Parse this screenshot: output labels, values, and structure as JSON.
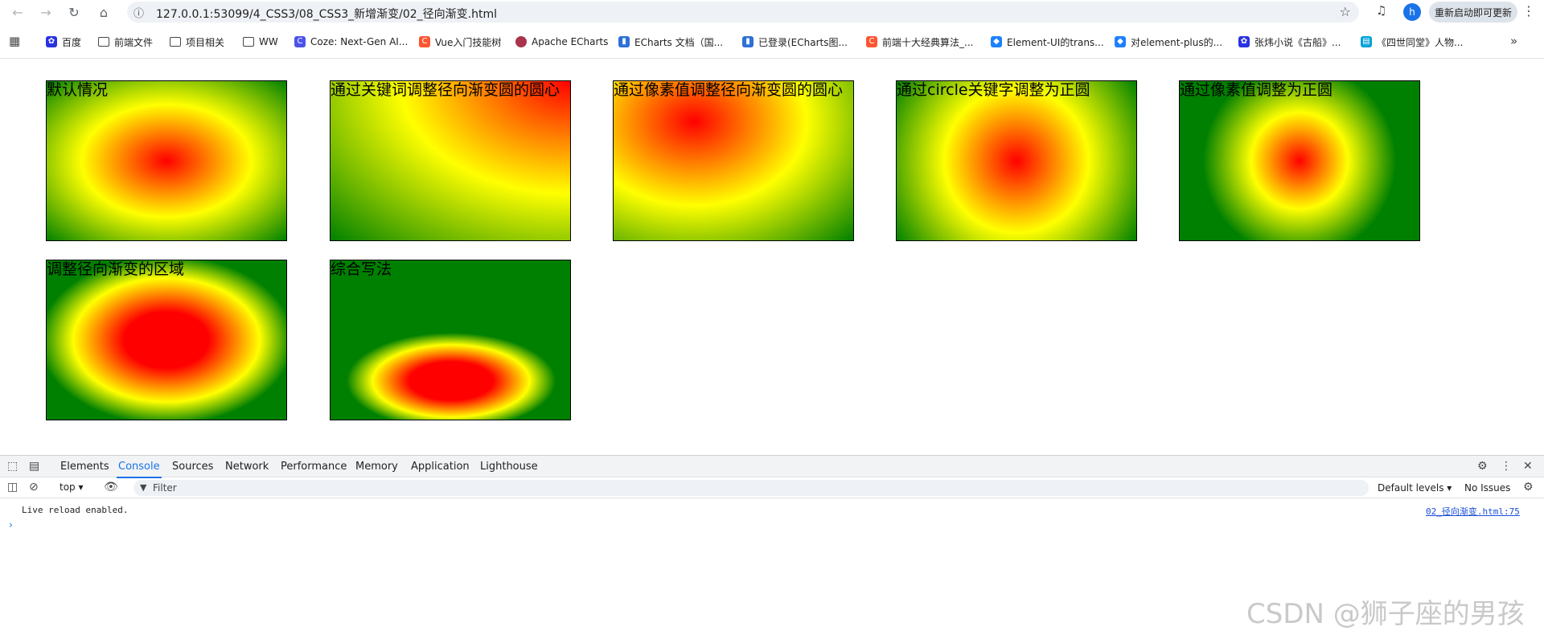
{
  "browser": {
    "url": "127.0.0.1:53099/4_CSS3/08_CSS3_新增渐变/02_径向渐变.html",
    "avatar_letter": "h",
    "update_button": "重新启动即可更新"
  },
  "bookmarks": [
    {
      "label": "百度",
      "icon": "paw-icon",
      "color": "#2932e1"
    },
    {
      "label": "前端文件",
      "icon": "folder-icon"
    },
    {
      "label": "项目相关",
      "icon": "folder-icon"
    },
    {
      "label": "WW",
      "icon": "folder-icon"
    },
    {
      "label": "Coze: Next-Gen AI...",
      "icon": "coze-icon",
      "color": "#4d53e8"
    },
    {
      "label": "Vue入门技能树",
      "icon": "csdn-icon",
      "color": "#fc5531"
    },
    {
      "label": "Apache ECharts",
      "icon": "echarts-icon",
      "color": "#aa344d"
    },
    {
      "label": "ECharts 文档（国...",
      "icon": "chart-icon",
      "color": "#2f6fd8"
    },
    {
      "label": "已登录(ECharts图...",
      "icon": "chart-icon",
      "color": "#2f6fd8"
    },
    {
      "label": "前端十大经典算法_...",
      "icon": "csdn-icon",
      "color": "#fc5531"
    },
    {
      "label": "Element-UI的trans...",
      "icon": "juejin-icon",
      "color": "#1e80ff"
    },
    {
      "label": "对element-plus的...",
      "icon": "juejin-icon",
      "color": "#1e80ff"
    },
    {
      "label": "张炜小说《古船》...",
      "icon": "paw-icon",
      "color": "#2932e1"
    },
    {
      "label": "《四世同堂》人物...",
      "icon": "bilibili-icon",
      "color": "#00a1d6"
    }
  ],
  "boxes": [
    {
      "caption": "默认情况"
    },
    {
      "caption": "通过关键词调整径向渐变圆的圆心"
    },
    {
      "caption": "通过像素值调整径向渐变圆的圆心"
    },
    {
      "caption": "通过circle关键字调整为正圆"
    },
    {
      "caption": "通过像素值调整为正圆"
    },
    {
      "caption": "调整径向渐变的区域"
    },
    {
      "caption": "综合写法"
    }
  ],
  "gradient_colors": [
    "#ff0000",
    "#ffff00",
    "#008000"
  ],
  "devtools": {
    "tabs": [
      "Elements",
      "Console",
      "Sources",
      "Network",
      "Performance",
      "Memory",
      "Application",
      "Lighthouse"
    ],
    "active_tab": "Console",
    "context": "top",
    "filter_placeholder": "Filter",
    "levels": "Default levels",
    "issues": "No Issues",
    "console_message": "Live reload enabled.",
    "console_source": "02_径向渐变.html:75"
  },
  "watermark": "CSDN @狮子座的男孩"
}
